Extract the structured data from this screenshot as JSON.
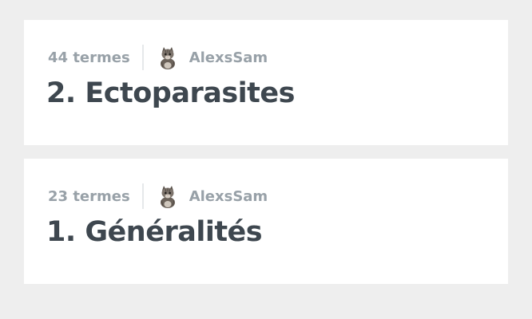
{
  "sets": [
    {
      "term_count": "44 termes",
      "author": "AlexsSam",
      "title": "2. Ectoparasites",
      "avatar_icon": "cat-avatar-icon"
    },
    {
      "term_count": "23 termes",
      "author": "AlexsSam",
      "title": "1. Généralités",
      "avatar_icon": "cat-avatar-icon"
    }
  ]
}
